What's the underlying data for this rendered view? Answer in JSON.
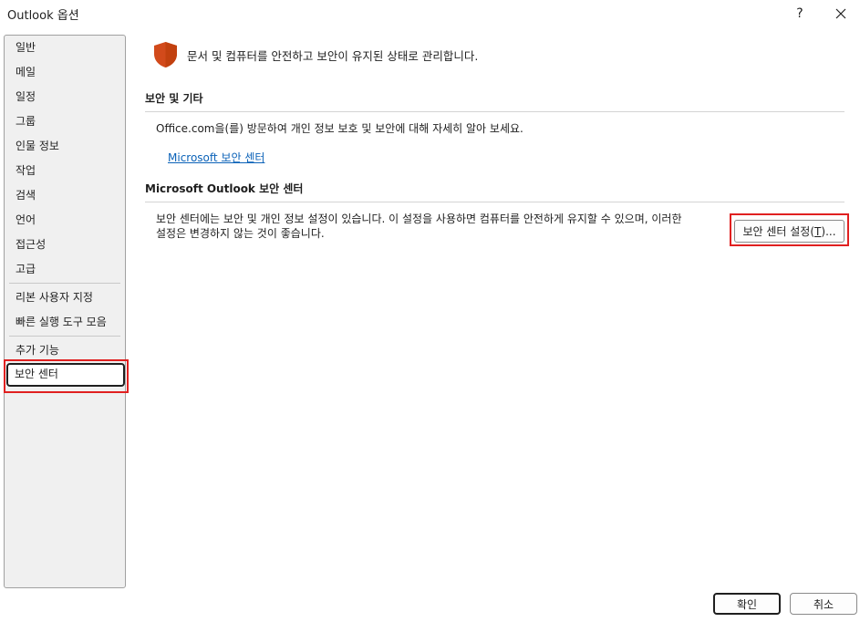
{
  "window": {
    "title": "Outlook 옵션",
    "help_label": "?"
  },
  "nav": {
    "items": [
      {
        "label": "일반"
      },
      {
        "label": "메일"
      },
      {
        "label": "일정"
      },
      {
        "label": "그룹"
      },
      {
        "label": "인물 정보"
      },
      {
        "label": "작업"
      },
      {
        "label": "검색"
      },
      {
        "label": "언어"
      },
      {
        "label": "접근성"
      },
      {
        "label": "고급"
      },
      {
        "label": "리본 사용자 지정"
      },
      {
        "label": "빠른 실행 도구 모음"
      },
      {
        "label": "추가 기능"
      },
      {
        "label": "보안 센터"
      }
    ],
    "selected": "보안 센터"
  },
  "header": {
    "icon": "shield-icon",
    "text": "문서 및 컴퓨터를 안전하고 보안이 유지된 상태로 관리합니다."
  },
  "security_section": {
    "title": "보안 및 기타",
    "description": "Office.com을(를) 방문하여 개인 정보 보호 및 보안에 대해 자세히 알아 보세요.",
    "link": "Microsoft 보안 센터"
  },
  "trust_center_section": {
    "title": "Microsoft Outlook 보안 센터",
    "description_line1": "보안 센터에는 보안 및 개인 정보 설정이 있습니다. 이 설정을 사용하면 컴퓨터를 안전하게 유지할 수 있으며, 이러한",
    "description_line2": "설정은 변경하지 않는 것이 좋습니다.",
    "button_label": "보안 센터 설정",
    "button_mnemonic": "T",
    "button_suffix": "..."
  },
  "footer": {
    "ok_label": "확인",
    "cancel_label": "취소"
  },
  "colors": {
    "shield": "#d24a1b",
    "link": "#0b62b8",
    "highlight": "#e02020"
  }
}
